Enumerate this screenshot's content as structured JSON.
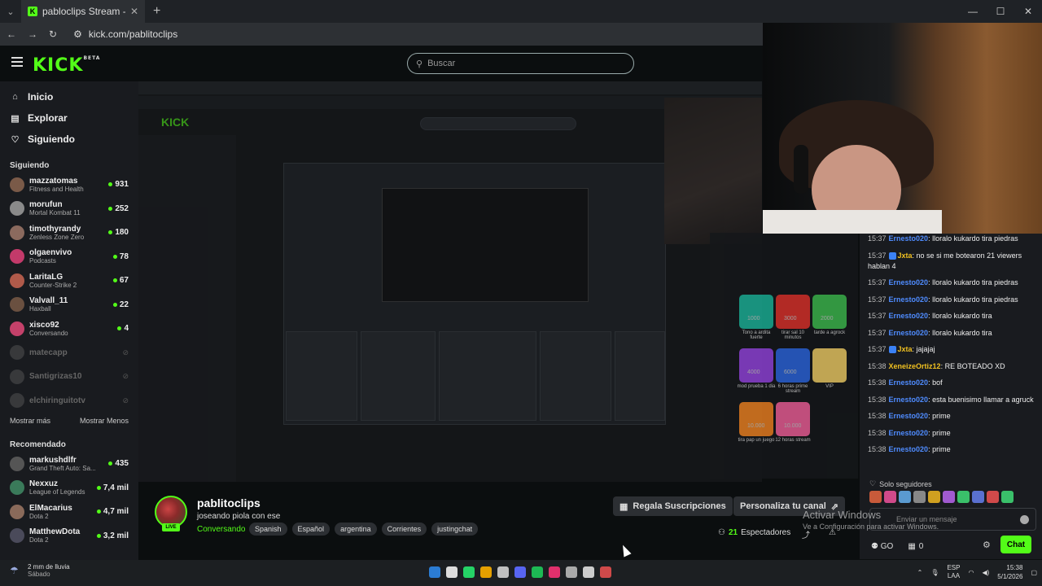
{
  "browser": {
    "tab_title": "pabloclips Stream - Watch Li...",
    "url": "kick.com/pablitoclips"
  },
  "header": {
    "logo": "KICK",
    "logo_beta": "BETA",
    "search_placeholder": "Buscar"
  },
  "sidebar": {
    "nav": [
      {
        "label": "Inicio",
        "icon": "home-icon"
      },
      {
        "label": "Explorar",
        "icon": "compass-icon"
      },
      {
        "label": "Siguiendo",
        "icon": "heart-icon"
      }
    ],
    "following_heading": "Siguiendo",
    "following": [
      {
        "name": "mazzatomas",
        "game": "Fitness and Health",
        "viewers": "931",
        "color": "#7a5a48"
      },
      {
        "name": "morufun",
        "game": "Mortal Kombat 11",
        "viewers": "252",
        "color": "#8a8a8a"
      },
      {
        "name": "timothyrandy",
        "game": "Zenless Zone Zero",
        "viewers": "180",
        "color": "#8b6a5e"
      },
      {
        "name": "olgaenvivo",
        "game": "Podcasts",
        "viewers": "78",
        "color": "#c33a6a"
      },
      {
        "name": "LaritaLG",
        "game": "Counter-Strike 2",
        "viewers": "67",
        "color": "#b05a4a"
      },
      {
        "name": "Valvall_11",
        "game": "Haxball",
        "viewers": "22",
        "color": "#6a5040"
      },
      {
        "name": "xisco92",
        "game": "Conversando",
        "viewers": "4",
        "color": "#c4416a"
      },
      {
        "name": "matecapp",
        "game": "",
        "viewers": "",
        "color": "#666"
      },
      {
        "name": "Santigrizas10",
        "game": "",
        "viewers": "",
        "color": "#666"
      },
      {
        "name": "elchiringuitotv",
        "game": "",
        "viewers": "",
        "color": "#666"
      }
    ],
    "show_more": "Mostrar más",
    "show_less": "Mostrar Menos",
    "recommended_heading": "Recomendado",
    "recommended": [
      {
        "name": "markushdlfr",
        "game": "Grand Theft Auto: Sa...",
        "viewers": "435",
        "color": "#555"
      },
      {
        "name": "Nexxuz",
        "game": "League of Legends",
        "viewers": "7,4 mil",
        "color": "#3a7a5a"
      },
      {
        "name": "ElMacarius",
        "game": "Dota 2",
        "viewers": "4,7 mil",
        "color": "#8a6a5a"
      },
      {
        "name": "MatthewDota",
        "game": "Dota 2",
        "viewers": "3,2 mil",
        "color": "#4a4a5a"
      }
    ]
  },
  "chat": {
    "messages": [
      {
        "time": "15:37",
        "user": "Ernesto020",
        "color": "#4f8cff",
        "badge": false,
        "text": ": lloralo kukardo tira piedras"
      },
      {
        "time": "15:37",
        "user": "Jxta",
        "color": "#f0c020",
        "badge": true,
        "text": ": no se si me botearon 21 viewers hablan 4"
      },
      {
        "time": "15:37",
        "user": "Ernesto020",
        "color": "#4f8cff",
        "badge": false,
        "text": ": lloralo kukardo tira piedras"
      },
      {
        "time": "15:37",
        "user": "Ernesto020",
        "color": "#4f8cff",
        "badge": false,
        "text": ": lloralo kukardo tira piedras"
      },
      {
        "time": "15:37",
        "user": "Ernesto020",
        "color": "#4f8cff",
        "badge": false,
        "text": ": lloralo kukardo tira"
      },
      {
        "time": "15:37",
        "user": "Ernesto020",
        "color": "#4f8cff",
        "badge": false,
        "text": ": lloralo kukardo tira"
      },
      {
        "time": "15:37",
        "user": "Jxta",
        "color": "#f0c020",
        "badge": true,
        "text": ": jajajaj"
      },
      {
        "time": "15:38",
        "user": "XeneizeOrtiz12",
        "color": "#f0c020",
        "badge": false,
        "text": ": RE BOTEADO XD"
      },
      {
        "time": "15:38",
        "user": "Ernesto020",
        "color": "#4f8cff",
        "badge": false,
        "text": ": bof"
      },
      {
        "time": "15:38",
        "user": "Ernesto020",
        "color": "#4f8cff",
        "badge": false,
        "text": ": esta buenisimo llamar a agruck"
      },
      {
        "time": "15:38",
        "user": "Ernesto020",
        "color": "#4f8cff",
        "badge": false,
        "text": ": prime"
      },
      {
        "time": "15:38",
        "user": "Ernesto020",
        "color": "#4f8cff",
        "badge": false,
        "text": ": prime"
      },
      {
        "time": "15:38",
        "user": "Ernesto020",
        "color": "#4f8cff",
        "badge": false,
        "text": ": prime"
      }
    ],
    "followers_only": "Solo seguidores",
    "input_placeholder": "Enviar un mensaje",
    "kicks_count": "0",
    "chat_button": "Chat",
    "emote_colors": [
      "#c85a3a",
      "#d04a8a",
      "#5a9ad0",
      "#888",
      "#d0a020",
      "#a05ad0",
      "#3ac06a",
      "#5a70d0",
      "#d04a4a",
      "#3ac06a"
    ]
  },
  "windows_activation": {
    "line1": "Activar Windows",
    "line2": "Ve a Configuración para activar Windows."
  },
  "stream": {
    "name": "pablitoclips",
    "title": "joseando piola con ese",
    "category": "Conversando",
    "tags": [
      "Spanish",
      "Español",
      "argentina",
      "Corrientes",
      "justingchat"
    ],
    "live_label": "LIVE",
    "gift_subs": "Regala Suscripciones",
    "customize": "Personaliza tu canal",
    "viewers": "21",
    "viewers_label": "Espectadores"
  },
  "taskbar": {
    "weather_main": "2 mm de lluvia",
    "weather_sub": "Sábado",
    "lang1": "ESP",
    "lang2": "LAA",
    "time": "15:38",
    "date": "5/1/2026",
    "icon_colors": [
      "#2b7cd3",
      "#ddd",
      "#25d366",
      "#e5a000",
      "#c0c0c0",
      "#5865f2",
      "#1db954",
      "#e1306c",
      "#aaa",
      "#ccc",
      "#d04a4a"
    ]
  },
  "nested_overlay": {
    "tiles": [
      {
        "label": "Tono a ardita fuerte",
        "cost": "1000",
        "color": "#1aa890"
      },
      {
        "label": "tirar sal 10 minutos",
        "cost": "3000",
        "color": "#d0302a"
      },
      {
        "label": "tarde a agrock",
        "cost": "2000",
        "color": "#3ab04a"
      },
      {
        "label": "mod prueba 1 dia",
        "cost": "4000",
        "color": "#8a40d0"
      },
      {
        "label": "6 horas prime stream",
        "cost": "6000",
        "color": "#2a60d0"
      },
      {
        "label": "VIP",
        "cost": "",
        "color": "#e0c060"
      },
      {
        "label": "tira pap un juego",
        "cost": "10.000",
        "color": "#e07a20"
      },
      {
        "label": "12 horas stream",
        "cost": "10.000",
        "color": "#e05a90"
      }
    ]
  }
}
